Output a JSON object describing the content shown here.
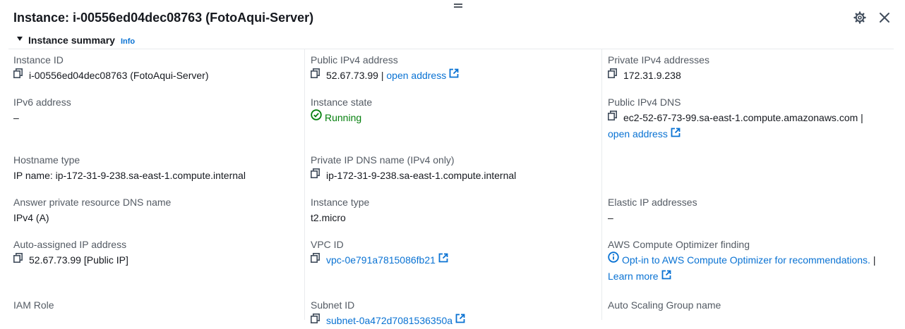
{
  "header": {
    "title": "Instance: i-00556ed04dec08763 (FotoAqui-Server)"
  },
  "summary": {
    "title": "Instance summary",
    "info": "Info"
  },
  "fields": {
    "instance_id": {
      "label": "Instance ID",
      "value": "i-00556ed04dec08763 (FotoAqui-Server)"
    },
    "public_ipv4": {
      "label": "Public IPv4 address",
      "value": "52.67.73.99 |",
      "link": "open address"
    },
    "private_ipv4": {
      "label": "Private IPv4 addresses",
      "value": "172.31.9.238"
    },
    "ipv6": {
      "label": "IPv6 address",
      "value": "–"
    },
    "instance_state": {
      "label": "Instance state",
      "value": "Running"
    },
    "public_dns": {
      "label": "Public IPv4 DNS",
      "value": "ec2-52-67-73-99.sa-east-1.compute.amazonaws.com |",
      "link": "open address"
    },
    "hostname_type": {
      "label": "Hostname type",
      "value": "IP name: ip-172-31-9-238.sa-east-1.compute.internal"
    },
    "private_dns": {
      "label": "Private IP DNS name (IPv4 only)",
      "value": "ip-172-31-9-238.sa-east-1.compute.internal"
    },
    "answer_dns": {
      "label": "Answer private resource DNS name",
      "value": "IPv4 (A)"
    },
    "instance_type": {
      "label": "Instance type",
      "value": "t2.micro"
    },
    "elastic_ip": {
      "label": "Elastic IP addresses",
      "value": "–"
    },
    "auto_ip": {
      "label": "Auto-assigned IP address",
      "value": "52.67.73.99 [Public IP]"
    },
    "vpc_id": {
      "label": "VPC ID",
      "link": "vpc-0e791a7815086fb21"
    },
    "optimizer": {
      "label": "AWS Compute Optimizer finding",
      "link": "Opt-in to AWS Compute Optimizer for recommendations.",
      "sep": " |",
      "learn": "Learn more"
    },
    "iam_role": {
      "label": "IAM Role"
    },
    "subnet_id": {
      "label": "Subnet ID",
      "link": "subnet-0a472d7081536350a"
    },
    "asg_name": {
      "label": "Auto Scaling Group name"
    }
  },
  "colors": {
    "link": "#0972d3",
    "running": "#037f0c",
    "label": "#545b64",
    "divider": "#e9ebed"
  }
}
